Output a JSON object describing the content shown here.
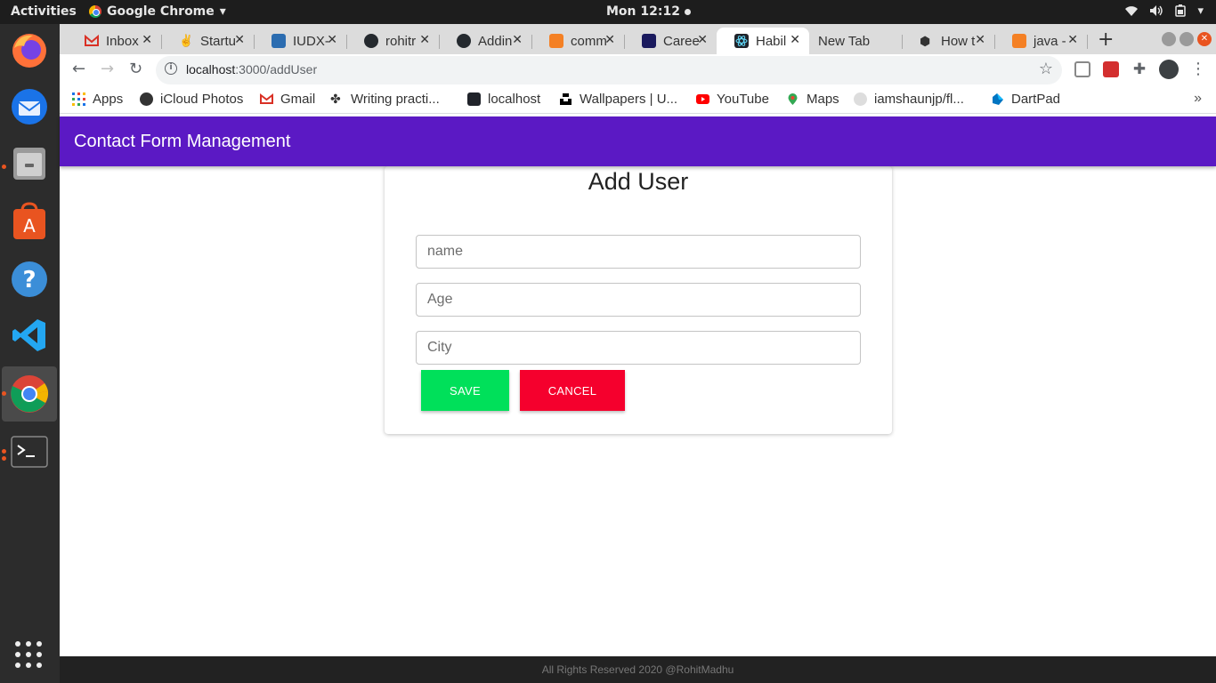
{
  "desktop": {
    "activities": "Activities",
    "app_name": "Google Chrome",
    "clock": "Mon 12:12"
  },
  "browser": {
    "tabs": [
      {
        "label": "Inbox",
        "favicon": "gmail-icon",
        "color": "#d93025"
      },
      {
        "label": "Startu",
        "favicon": "victory-hand-icon",
        "color": "#333333"
      },
      {
        "label": "IUDX-",
        "favicon": "iudx-icon",
        "color": "#2b6cb0"
      },
      {
        "label": "rohitr",
        "favicon": "github-icon",
        "color": "#24292e"
      },
      {
        "label": "Addin",
        "favicon": "github-icon",
        "color": "#24292e"
      },
      {
        "label": "comm",
        "favicon": "stackoverflow-icon",
        "color": "#f48024"
      },
      {
        "label": "Caree",
        "favicon": "career-icon",
        "color": "#1a1a5e"
      },
      {
        "label": "Habil",
        "favicon": "react-icon",
        "color": "#61dafb",
        "active": true
      },
      {
        "label": "New Tab",
        "favicon": "",
        "color": ""
      },
      {
        "label": "How t",
        "favicon": "hexagon-icon",
        "color": "#111111"
      },
      {
        "label": "java -",
        "favicon": "stackoverflow-icon",
        "color": "#f48024"
      }
    ],
    "url_host": "localhost",
    "url_rest": ":3000/addUser",
    "bookmarks": [
      {
        "label": "Apps",
        "icon": "apps-grid-icon"
      },
      {
        "label": "iCloud Photos",
        "icon": "icloud-icon"
      },
      {
        "label": "Gmail",
        "icon": "gmail-icon"
      },
      {
        "label": "Writing practi...",
        "icon": "writing-icon"
      },
      {
        "label": "localhost",
        "icon": "react-icon"
      },
      {
        "label": "Wallpapers | U...",
        "icon": "unsplash-icon"
      },
      {
        "label": "YouTube",
        "icon": "youtube-icon"
      },
      {
        "label": "Maps",
        "icon": "maps-icon"
      },
      {
        "label": "iamshaunjp/fl...",
        "icon": "github-icon"
      },
      {
        "label": "DartPad",
        "icon": "dart-icon"
      }
    ],
    "more": "»"
  },
  "app": {
    "title": "Contact Form Management",
    "form_title": "Add User",
    "fields": {
      "name_placeholder": "name",
      "age_placeholder": "Age",
      "city_placeholder": "City"
    },
    "save_label": "SAVE",
    "cancel_label": "CANCEL",
    "footer": "All Rights Reserved 2020 @RohitMadhu"
  },
  "colors": {
    "appbar": "#5b19c4",
    "save": "#00e05a",
    "cancel": "#f5002d"
  }
}
